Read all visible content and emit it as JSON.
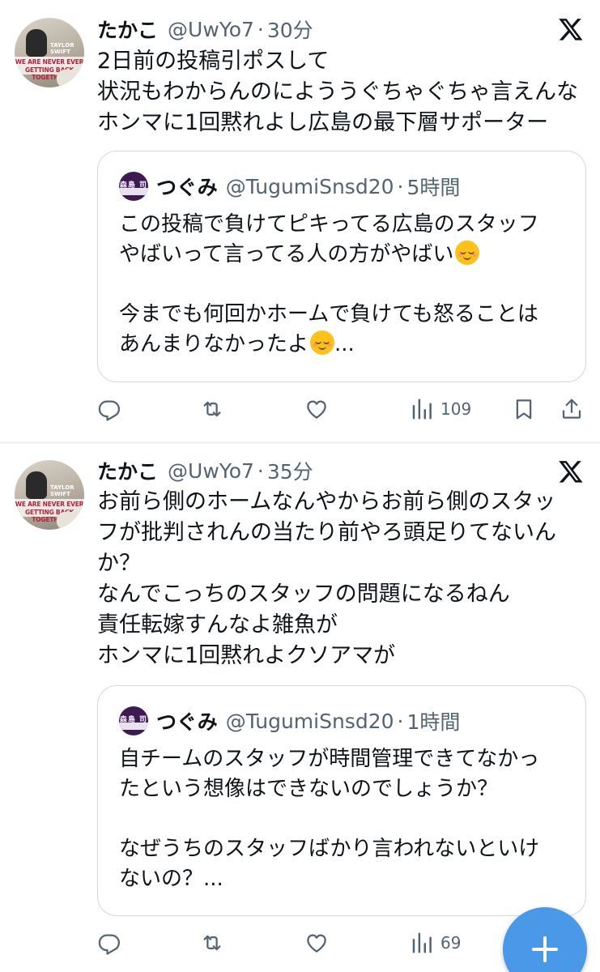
{
  "icons": {
    "reply": "speech-bubble",
    "retweet": "retweet-arrows",
    "like": "heart-outline",
    "views": "bar-chart",
    "bookmark": "bookmark-outline",
    "share": "share-upload",
    "platform": "x-logo",
    "compose": "plus"
  },
  "colors": {
    "accent": "#4a99e9",
    "secondary_text": "#536471",
    "primary_text": "#0f1419",
    "border": "#cfd9de"
  },
  "tweets": [
    {
      "author": {
        "name": "たかこ",
        "handle": "@UwYo7",
        "avatar_text_1": "WE ARE NEVER EVER",
        "avatar_text_2": "GETTING BACK TOGETHER",
        "avatar_text_3": "TAYLOR SWIFT"
      },
      "separator": "·",
      "time": "30分",
      "text_lines": [
        "2日前の投稿引ポスして",
        "状況もわからんのによううぐちゃぐちゃ言えんな",
        "ホンマに1回黙れよし広島の最下層サポーター"
      ],
      "quote": {
        "author": {
          "name": "つぐみ",
          "handle": "@TugumiSnsd20",
          "avatar_text": "森島 司"
        },
        "separator": "·",
        "time": "5時間",
        "line_1": "この投稿で負けてピキってる広島のスタッフ",
        "line_2": "やばいって言ってる人の方がやばい",
        "line_3": "",
        "line_4": "今までも何回かホームで負けても怒ることは",
        "line_5": "あんまりなかったよ",
        "line_5_suffix": "...",
        "emoji": "relieved-face"
      },
      "actions": {
        "views": "109"
      }
    },
    {
      "author": {
        "name": "たかこ",
        "handle": "@UwYo7",
        "avatar_text_1": "WE ARE NEVER EVER",
        "avatar_text_2": "GETTING BACK TOGETHER",
        "avatar_text_3": "TAYLOR SWIFT"
      },
      "separator": "·",
      "time": "35分",
      "text_lines": [
        "お前ら側のホームなんやからお前ら側のスタッ",
        "フが批判されんの当たり前やろ頭足りてないん",
        "か？",
        "なんでこっちのスタッフの問題になるねん",
        "責任転嫁すんなよ雑魚が",
        "ホンマに1回黙れよクソアマが"
      ],
      "quote": {
        "author": {
          "name": "つぐみ",
          "handle": "@TugumiSnsd20",
          "avatar_text": "森島 司"
        },
        "separator": "·",
        "time": "1時間",
        "text_lines": [
          "自チームのスタッフが時間管理できてなかっ",
          "たという想像はできないのでしょうか？",
          "",
          "なぜうちのスタッフばかり言われないといけ",
          "ないの？..."
        ]
      },
      "actions": {
        "views": "69"
      }
    }
  ]
}
